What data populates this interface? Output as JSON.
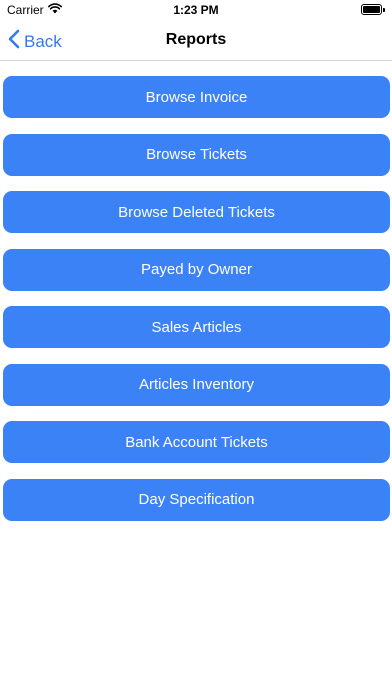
{
  "status_bar": {
    "carrier": "Carrier",
    "time": "1:23 PM",
    "wifi_icon": "wifi-icon",
    "battery_icon": "battery-icon"
  },
  "nav": {
    "back_label": "Back",
    "back_icon": "chevron-left-icon",
    "title": "Reports"
  },
  "colors": {
    "accent": "#3478f6",
    "button_bg": "#3b82f6",
    "button_text": "#ffffff"
  },
  "menu": {
    "items": [
      {
        "label": "Browse Invoice"
      },
      {
        "label": "Browse Tickets"
      },
      {
        "label": "Browse Deleted Tickets"
      },
      {
        "label": "Payed by Owner"
      },
      {
        "label": "Sales Articles"
      },
      {
        "label": "Articles Inventory"
      },
      {
        "label": "Bank Account Tickets"
      },
      {
        "label": "Day Specification"
      }
    ]
  }
}
